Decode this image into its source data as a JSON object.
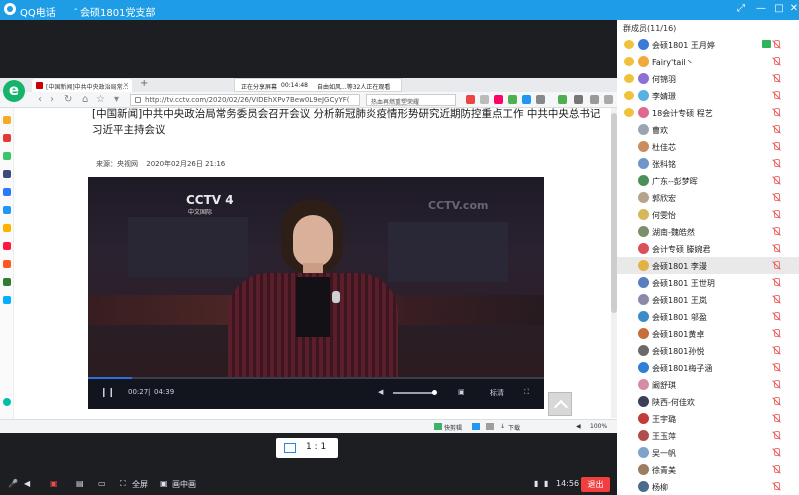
{
  "titlebar": {
    "app": "QQ电话",
    "separator": "-",
    "group": "会硕1801党支部"
  },
  "browser": {
    "tab_title": "[中国新闻]中共中央政治局常...",
    "share_status": "正在分享屏幕",
    "share_time": "00:14:48",
    "share_viewers": "自由如风...等32人正在观看",
    "url": "http://tv.cctv.com/2020/02/26/VIDEhXPv7Bew0L9eJGCyYF(",
    "hot_search": "热血再燃重塑荣耀",
    "logo": "e"
  },
  "article": {
    "title": "[中国新闻]中共中央政治局常务委员会召开会议 分析新冠肺炎疫情形势研究近期防控重点工作 中共中央总书记习近平主持会议",
    "source": "来源：央视网",
    "date": "2020年02月26日 21:16"
  },
  "video": {
    "channel_logo": "CCTV 4",
    "channel_sub": "中文国际",
    "watermark": "CCTV.com",
    "current_time": "00:27",
    "duration": "04:39",
    "progress": 0.097,
    "volume_label": "音量",
    "quality_label": "标清"
  },
  "statusbar": {
    "item1": "快剪辑",
    "item2": "下载",
    "zoom": "100%"
  },
  "ratio": {
    "label": "1 : 1"
  },
  "bottombar": {
    "fullscreen": "全屏",
    "pip": "画中画",
    "time": "14:56",
    "exit": "退出"
  },
  "sidebar": {
    "header": "群成员(11/16)",
    "members": [
      {
        "name": "会硕1801 王月婷",
        "color": "#3a7bd5",
        "owner": true,
        "cam": true
      },
      {
        "name": "Fairy'tail丶",
        "color": "#f2a93b",
        "owner": true
      },
      {
        "name": "何锦羽",
        "color": "#8e6fd6",
        "owner": true
      },
      {
        "name": "李婧璟",
        "color": "#5ab0e0",
        "owner": true
      },
      {
        "name": "18会计专硕 程艺",
        "color": "#e06a8f",
        "owner": true
      },
      {
        "name": "曹欢",
        "color": "#9aa5b1"
      },
      {
        "name": "杜佳芯",
        "color": "#c98d5e"
      },
      {
        "name": "张科铭",
        "color": "#6f95c9"
      },
      {
        "name": "广东--彭梦晖",
        "color": "#4d8f5b"
      },
      {
        "name": "郭欣宏",
        "color": "#b5a38d"
      },
      {
        "name": "何雯怡",
        "color": "#d6b85c"
      },
      {
        "name": "湖南-魏皓然",
        "color": "#7a8f6c"
      },
      {
        "name": "会计专硕 滕婉君",
        "color": "#d9505a"
      },
      {
        "name": "会硕1801 李漫",
        "color": "#e3b247",
        "selected": true
      },
      {
        "name": "会硕1801 王世玥",
        "color": "#5a7fbf"
      },
      {
        "name": "会硕1801 王岚",
        "color": "#8a8aa8"
      },
      {
        "name": "会硕1801 邬盈",
        "color": "#3c8dc7"
      },
      {
        "name": "会硕1801黄卓",
        "color": "#c76f3c"
      },
      {
        "name": "会硕1801孙悦",
        "color": "#6a6a6a"
      },
      {
        "name": "会硕1801梅子涵",
        "color": "#2f7fd6"
      },
      {
        "name": "阚舒琪",
        "color": "#d68ca4"
      },
      {
        "name": "陕西-何佳欢",
        "color": "#3d3d5c"
      },
      {
        "name": "王宇璐",
        "color": "#c23b3b"
      },
      {
        "name": "王玉萍",
        "color": "#b04d4d"
      },
      {
        "name": "吴一帆",
        "color": "#7fa4c9"
      },
      {
        "name": "徐青美",
        "color": "#9c7d5e"
      },
      {
        "name": "杨柳",
        "color": "#4a6d8c"
      }
    ]
  }
}
